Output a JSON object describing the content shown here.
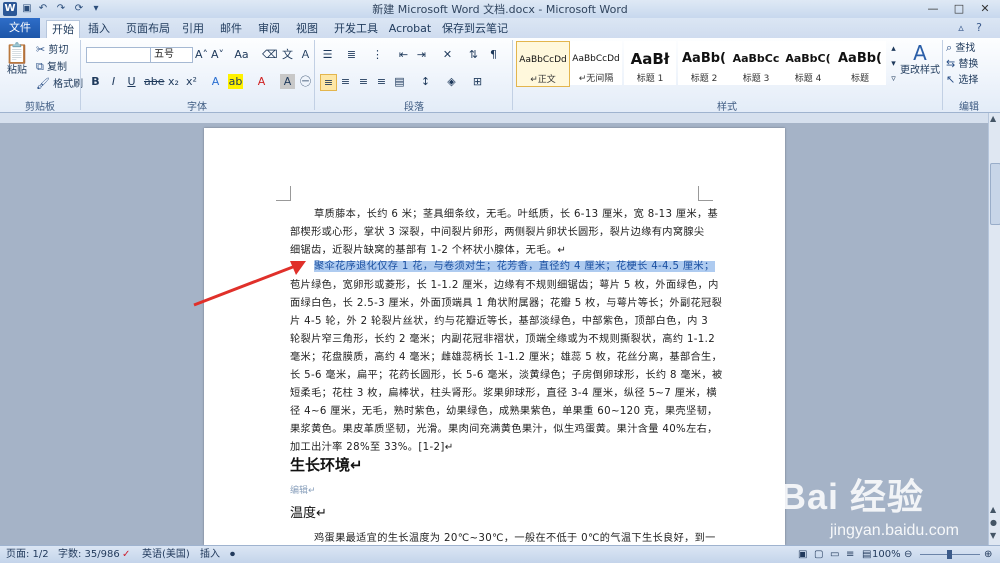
{
  "window": {
    "title": "新建 Microsoft Word 文档.docx - Microsoft Word",
    "app_icon_letter": "W",
    "controls": [
      "—",
      "□",
      "✕"
    ]
  },
  "tabs": [
    "文件",
    "开始",
    "插入",
    "页面布局",
    "引用",
    "邮件",
    "审阅",
    "视图",
    "开发工具",
    "Acrobat",
    "保存到云笔记"
  ],
  "ribbon": {
    "clipboard": {
      "paste": "粘贴",
      "cut": "剪切",
      "copy": "复制",
      "format_painter": "格式刷",
      "label": "剪贴板"
    },
    "font": {
      "font_name": "",
      "font_size": "五号",
      "label": "字体"
    },
    "paragraph": {
      "label": "段落"
    },
    "styles": {
      "tiles": [
        {
          "sample": "AaBbCcDd",
          "name": "↵正文"
        },
        {
          "sample": "AaBbCcDd",
          "name": "↵无间隔"
        },
        {
          "sample": "AaBł",
          "name": "标题 1"
        },
        {
          "sample": "AaBb(",
          "name": "标题 2"
        },
        {
          "sample": "AaBbCc",
          "name": "标题 3"
        },
        {
          "sample": "AaBbC(",
          "name": "标题 4"
        },
        {
          "sample": "AaBb(",
          "name": "标题"
        }
      ],
      "change_styles": "更改样式",
      "label": "样式"
    },
    "editing": {
      "find": "查找",
      "replace": "替换",
      "select": "选择",
      "label": "编辑"
    }
  },
  "document": {
    "lines": [
      "草质藤本，长约 6 米；茎具细条纹，无毛。叶纸质，长 6-13 厘米，宽 8-13 厘米，基",
      "部楔形或心形，掌状 3 深裂，中间裂片卵形，两侧裂片卵状长圆形，裂片边缘有内窝腺尖",
      "细锯齿，近裂片缺窝的基部有 1-2 个杯状小腺体，无毛。↵",
      "聚伞花序退化仅存 1 花，与卷须对生；花芳香，直径约 4 厘米；花梗长 4-4.5 厘米；",
      "苞片绿色，宽卵形或菱形，长 1-1.2 厘米，边缘有不规则细锯齿；萼片 5 枚，外面绿色，内",
      "面绿白色，长 2.5-3 厘米，外面顶端具 1 角状附属器；花瓣 5 枚，与萼片等长；外副花冠裂",
      "片 4-5 轮，外 2 轮裂片丝状，约与花瓣近等长，基部淡绿色，中部紫色，顶部白色，内 3",
      "轮裂片窄三角形，长约 2 毫米；内副花冠非褶状，顶端全缘或为不规则撕裂状，高约 1-1.2",
      "毫米；花盘膜质，高约 4 毫米；雌雄蕊柄长 1-1.2 厘米；雄蕊 5 枚，花丝分离，基部合生，",
      "长 5-6 毫米，扁平；花药长圆形，长 5-6 毫米，淡黄绿色；子房倒卵球形，长约 8 毫米，被",
      "短柔毛；花柱 3 枚，扁棒状，柱头肾形。浆果卵球形，直径 3-4 厘米，纵径 5~7 厘米，横",
      "径 4~6 厘米，无毛，熟时紫色，幼果绿色，成熟果紫色，单果重 60~120 克，果壳坚韧，",
      "果浆黄色。果皮革质坚韧，光滑。果肉间充满黄色果汁，似生鸡蛋黄。果汁含量 40%左右，",
      "加工出汁率 28%至 33%。[1-2]↵"
    ],
    "heading1": "生长环境↵",
    "edit_link": "编辑↵",
    "heading2": "温度↵",
    "last_line": "鸡蛋果最适宜的生长温度为 20℃~30℃，一般在不低于 0℃的气温下生长良好，到一"
  },
  "status": {
    "page": "页面: 1/2",
    "words": "字数: 35/986",
    "language": "英语(美国)",
    "insert": "插入",
    "zoom": "100%"
  },
  "watermark": {
    "text": "Bai 经验",
    "sub": "jingyan.baidu.com"
  },
  "colors": {
    "highlight": "#aecbf0",
    "arrow": "#e0302a",
    "file_tab": "#2b5797"
  }
}
